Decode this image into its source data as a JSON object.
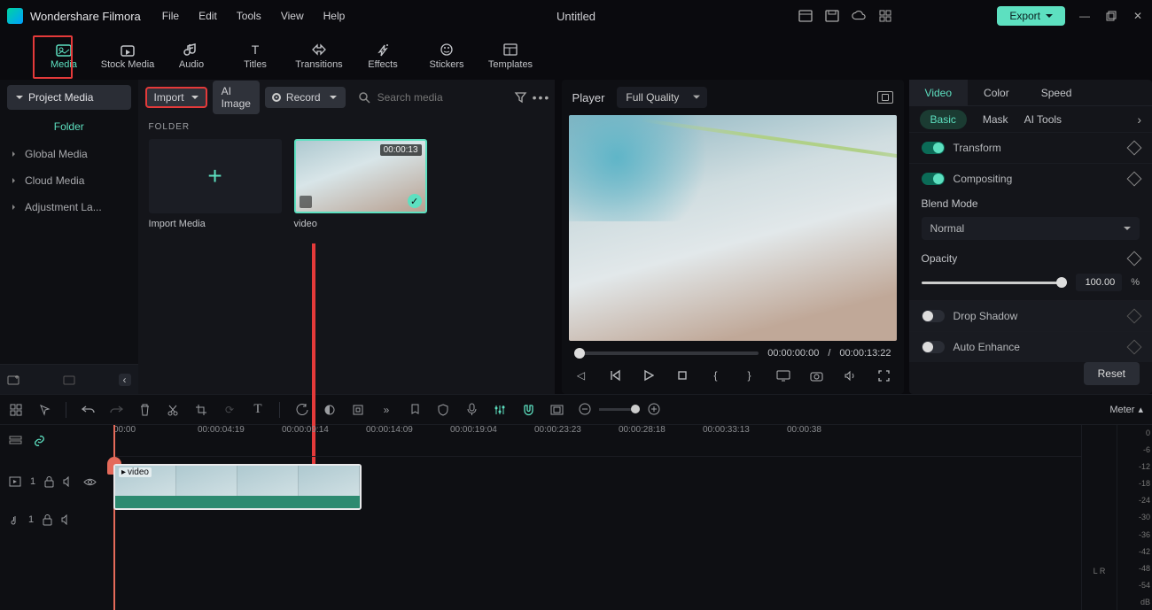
{
  "app": {
    "name": "Wondershare Filmora",
    "doc_title": "Untitled"
  },
  "menu": [
    "File",
    "Edit",
    "Tools",
    "View",
    "Help"
  ],
  "export_label": "Export",
  "tool_tabs": [
    {
      "key": "media",
      "label": "Media"
    },
    {
      "key": "stock",
      "label": "Stock Media"
    },
    {
      "key": "audio",
      "label": "Audio"
    },
    {
      "key": "titles",
      "label": "Titles"
    },
    {
      "key": "transitions",
      "label": "Transitions"
    },
    {
      "key": "effects",
      "label": "Effects"
    },
    {
      "key": "stickers",
      "label": "Stickers"
    },
    {
      "key": "templates",
      "label": "Templates"
    }
  ],
  "sidebar": {
    "project_media": "Project Media",
    "folder": "Folder",
    "items": [
      "Global Media",
      "Cloud Media",
      "Adjustment La..."
    ]
  },
  "media_bar": {
    "import": "Import",
    "ai_image": "AI Image",
    "record": "Record",
    "search_placeholder": "Search media"
  },
  "media_panel": {
    "section": "FOLDER",
    "import_tile": "Import Media",
    "clip_name": "video",
    "clip_dur": "00:00:13"
  },
  "player": {
    "label": "Player",
    "quality": "Full Quality",
    "current": "00:00:00:00",
    "total": "00:00:13:22"
  },
  "right": {
    "tabs": [
      "Video",
      "Color",
      "Speed"
    ],
    "subtabs": [
      "Basic",
      "Mask",
      "AI Tools"
    ],
    "transform": "Transform",
    "compositing": "Compositing",
    "blend_mode_lbl": "Blend Mode",
    "blend_mode_val": "Normal",
    "opacity_lbl": "Opacity",
    "opacity_val": "100.00",
    "opacity_unit": "%",
    "drop_shadow": "Drop Shadow",
    "auto_enhance": "Auto Enhance",
    "reset": "Reset"
  },
  "timeline": {
    "meter": "Meter",
    "ruler": [
      "00:00",
      "00:00:04:19",
      "00:00:09:14",
      "00:00:14:09",
      "00:00:19:04",
      "00:00:23:23",
      "00:00:28:18",
      "00:00:33:13",
      "00:00:38"
    ],
    "clip_label": "video",
    "db": [
      "0",
      "-6",
      "-12",
      "-18",
      "-24",
      "-30",
      "-36",
      "-42",
      "-48",
      "-54",
      "dB"
    ],
    "lr": "L    R"
  }
}
